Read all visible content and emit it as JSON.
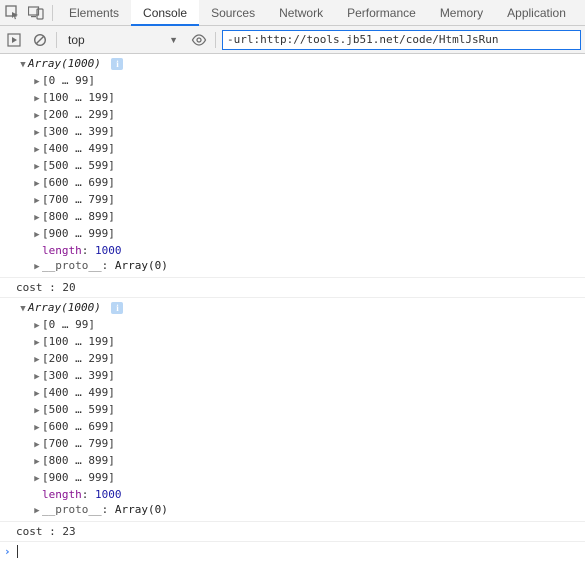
{
  "tabs": {
    "items": [
      "Elements",
      "Console",
      "Sources",
      "Network",
      "Performance",
      "Memory",
      "Application"
    ],
    "activeIndex": 1
  },
  "toolbar": {
    "context": "top",
    "filterValue": "-url:http://tools.jb51.net/code/HtmlJsRun"
  },
  "icons": {
    "inspect": "inspect-icon",
    "device": "device-icon",
    "play": "play-icon",
    "clear": "clear-icon",
    "eye": "eye-icon"
  },
  "logs": [
    {
      "type": "array",
      "header": "Array(1000)",
      "ranges": [
        "[0 … 99]",
        "[100 … 199]",
        "[200 … 299]",
        "[300 … 399]",
        "[400 … 499]",
        "[500 … 599]",
        "[600 … 699]",
        "[700 … 799]",
        "[800 … 899]",
        "[900 … 999]"
      ],
      "lengthKey": "length",
      "lengthVal": "1000",
      "protoKey": "__proto__",
      "protoVal": "Array(0)"
    },
    {
      "type": "text",
      "text": "cost : 20"
    },
    {
      "type": "array",
      "header": "Array(1000)",
      "ranges": [
        "[0 … 99]",
        "[100 … 199]",
        "[200 … 299]",
        "[300 … 399]",
        "[400 … 499]",
        "[500 … 599]",
        "[600 … 699]",
        "[700 … 799]",
        "[800 … 899]",
        "[900 … 999]"
      ],
      "lengthKey": "length",
      "lengthVal": "1000",
      "protoKey": "__proto__",
      "protoVal": "Array(0)"
    },
    {
      "type": "text",
      "text": "cost : 23"
    }
  ]
}
